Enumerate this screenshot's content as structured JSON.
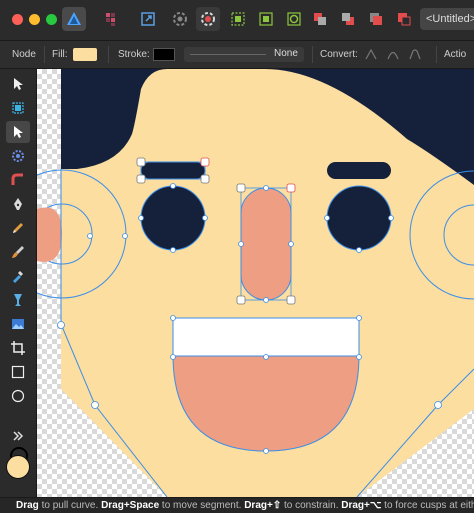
{
  "window": {
    "document_tab": "<Untitled>"
  },
  "context_toolbar": {
    "node_label": "Node",
    "fill_label": "Fill:",
    "fill_color": "#fbdea0",
    "stroke_label": "Stroke:",
    "stroke_color": "#000000",
    "stroke_width_value": "None",
    "convert_label": "Convert:",
    "action_label": "Actio"
  },
  "tools": [
    "move-tool",
    "artboard-tool",
    "node-tool",
    "point-transform-tool",
    "corner-tool",
    "pen-tool",
    "pencil-tool",
    "vector-brush-tool",
    "fill-tool",
    "transparency-tool",
    "place-image-tool",
    "crop-tool",
    "rectangle-tool",
    "ellipse-tool"
  ],
  "colors": {
    "accent": "#3c8ee8",
    "face": "#fbdea0",
    "hair": "#15213a",
    "nose": "#ee9e82",
    "mouth": "#ee9e82",
    "teeth": "#ffffff"
  },
  "status_bar": {
    "k1": "Drag",
    "t1": " to pull curve. ",
    "k2": "Drag+Space",
    "t2": " to move segment. ",
    "k3": "Drag+⇧",
    "t3": " to constrain. ",
    "k4": "Drag+⌥",
    "t4": " to force cusps at either end of c"
  }
}
